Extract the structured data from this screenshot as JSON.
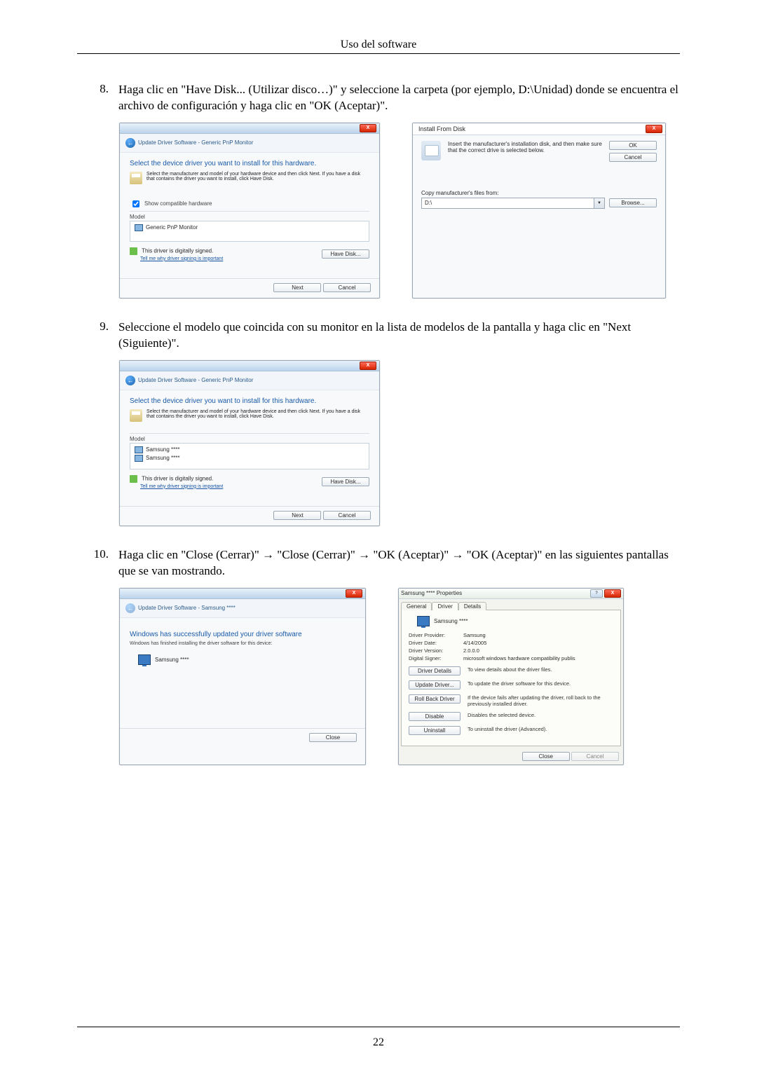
{
  "page": {
    "header": "Uso del software",
    "number": "22"
  },
  "steps": {
    "s8": {
      "num": "8.",
      "text": "Haga clic en \"Have Disk... (Utilizar disco…)\" y seleccione la carpeta (por ejemplo, D:\\Unidad) donde se encuentra el archivo de configuración y haga clic en \"OK (Aceptar)\"."
    },
    "s9": {
      "num": "9.",
      "text": "Seleccione el modelo que coincida con su monitor en la lista de modelos de la pantalla y haga clic en \"Next (Siguiente)\"."
    },
    "s10": {
      "num": "10.",
      "text": "Haga clic en \"Close (Cerrar)\" → \"Close (Cerrar)\" → \"OK (Aceptar)\" → \"OK (Aceptar)\" en las siguientes pantallas que se van mostrando."
    }
  },
  "wizard1": {
    "breadcrumb": "Update Driver Software - Generic PnP Monitor",
    "prompt": "Select the device driver you want to install for this hardware.",
    "hint": "Select the manufacturer and model of your hardware device and then click Next. If you have a disk that contains the driver you want to install, click Have Disk.",
    "show_compat": "Show compatible hardware",
    "model_header": "Model",
    "model_item": "Generic PnP Monitor",
    "signed": "This driver is digitally signed.",
    "signed_link": "Tell me why driver signing is important",
    "have_disk": "Have Disk...",
    "next": "Next",
    "cancel": "Cancel"
  },
  "install_disk": {
    "title": "Install From Disk",
    "msg": "Insert the manufacturer's installation disk, and then make sure that the correct drive is selected below.",
    "ok": "OK",
    "cancel": "Cancel",
    "copy_label": "Copy manufacturer's files from:",
    "path": "D:\\",
    "browse": "Browse..."
  },
  "wizard2": {
    "breadcrumb": "Update Driver Software - Generic PnP Monitor",
    "prompt": "Select the device driver you want to install for this hardware.",
    "hint": "Select the manufacturer and model of your hardware device and then click Next. If you have a disk that contains the driver you want to install, click Have Disk.",
    "model_header": "Model",
    "model_item1": "Samsung ****",
    "model_item2": "Samsung ****",
    "signed": "This driver is digitally signed.",
    "signed_link": "Tell me why driver signing is important",
    "have_disk": "Have Disk...",
    "next": "Next",
    "cancel": "Cancel"
  },
  "success": {
    "breadcrumb": "Update Driver Software - Samsung ****",
    "prompt": "Windows has successfully updated your driver software",
    "sub": "Windows has finished installing the driver software for this device:",
    "device": "Samsung ****",
    "close": "Close"
  },
  "props": {
    "title": "Samsung **** Properties",
    "tabs": {
      "general": "General",
      "driver": "Driver",
      "details": "Details"
    },
    "device": "Samsung ****",
    "kv": {
      "provider_k": "Driver Provider:",
      "provider_v": "Samsung",
      "date_k": "Driver Date:",
      "date_v": "4/14/2005",
      "version_k": "Driver Version:",
      "version_v": "2.0.0.0",
      "signer_k": "Digital Signer:",
      "signer_v": "microsoft windows hardware compatibility publis"
    },
    "buttons": {
      "details": {
        "label": "Driver Details",
        "desc": "To view details about the driver files."
      },
      "update": {
        "label": "Update Driver...",
        "desc": "To update the driver software for this device."
      },
      "rollback": {
        "label": "Roll Back Driver",
        "desc": "If the device fails after updating the driver, roll back to the previously installed driver."
      },
      "disable": {
        "label": "Disable",
        "desc": "Disables the selected device."
      },
      "uninstall": {
        "label": "Uninstall",
        "desc": "To uninstall the driver (Advanced)."
      }
    },
    "close": "Close",
    "cancel": "Cancel"
  }
}
